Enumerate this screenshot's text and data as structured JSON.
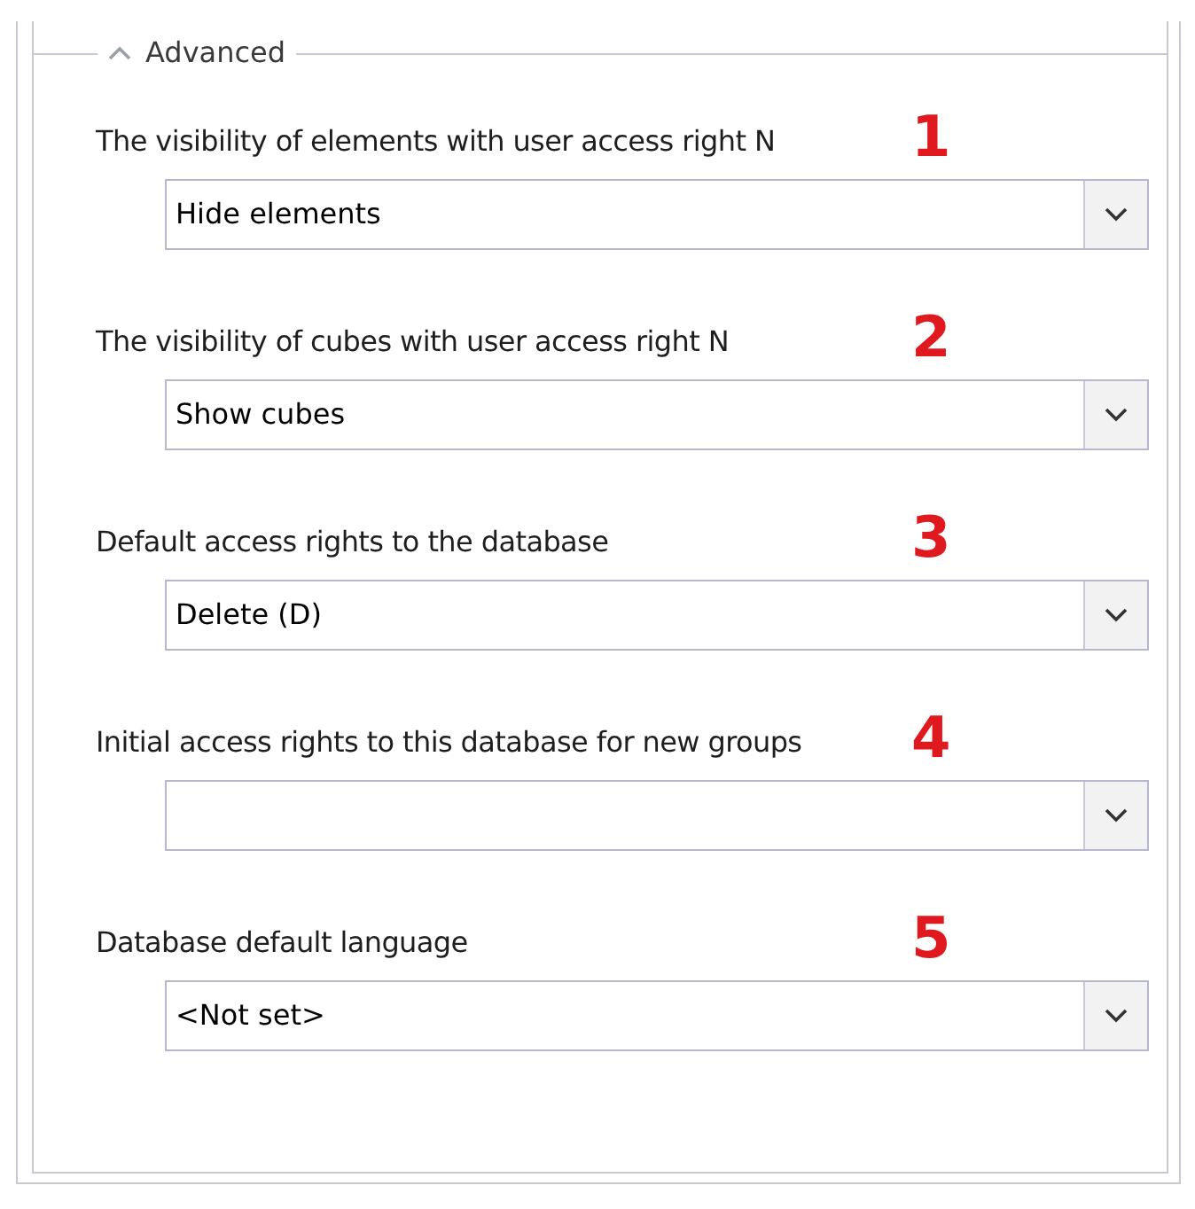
{
  "section": {
    "title": "Advanced",
    "expanded": true
  },
  "fields": [
    {
      "label": "The visibility of elements with user access right N",
      "marker": "1",
      "value": "Hide elements"
    },
    {
      "label": "The visibility of cubes with user access right N",
      "marker": "2",
      "value": "Show cubes"
    },
    {
      "label": "Default access rights to the database",
      "marker": "3",
      "value": "Delete (D)"
    },
    {
      "label": "Initial access rights to this database for new groups",
      "marker": "4"
    },
    {
      "label": "Database default language",
      "marker": "5",
      "value": "<Not set>"
    }
  ]
}
